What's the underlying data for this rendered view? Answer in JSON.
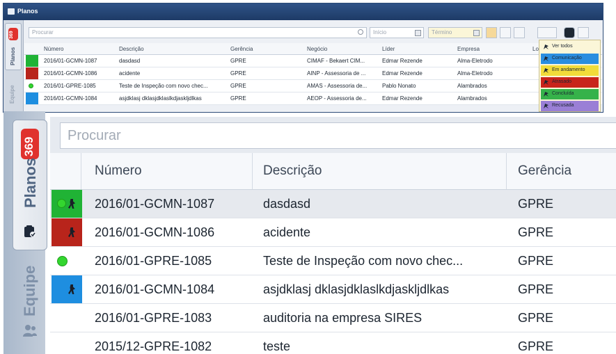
{
  "small": {
    "title": "Planos",
    "sidebar": {
      "badge": "369",
      "tab_planos": "Planos",
      "tab_equipe": "Equipe"
    },
    "search_placeholder": "Procurar",
    "date_start_placeholder": "Início",
    "date_end_placeholder": "Término",
    "columns": [
      "Número",
      "Descrição",
      "Gerência",
      "Negócio",
      "Líder",
      "Empresa",
      "Lo"
    ],
    "rows": [
      {
        "status": "green-run",
        "numero": "2016/01-GCMN-1087",
        "descricao": "dasdasd",
        "gerencia": "GPRE",
        "negocio": "CIMAF - Bekaert CIM...",
        "lider": "Edmar Rezende",
        "empresa": "Alma-Eletrodo"
      },
      {
        "status": "red",
        "numero": "2016/01-GCMN-1086",
        "descricao": "acidente",
        "gerencia": "GPRE",
        "negocio": "AINP - Assessoria de ...",
        "lider": "Edmar Rezende",
        "empresa": "Alma-Eletrodo"
      },
      {
        "status": "green-dot",
        "numero": "2016/01-GPRE-1085",
        "descricao": "Teste de Inspeção com novo chec...",
        "gerencia": "GPRE",
        "negocio": "AMAS - Assessoria de...",
        "lider": "Pablo Nonato",
        "empresa": "Alambrados"
      },
      {
        "status": "blue",
        "numero": "2016/01-GCMN-1084",
        "descricao": "asjdklasj dklasjdklaslkdjaskljdlkas",
        "gerencia": "GPRE",
        "negocio": "AEOP - Assessoria de...",
        "lider": "Edmar Rezende",
        "empresa": "Alambrados"
      }
    ],
    "filter_menu": [
      {
        "label": "Ver todos",
        "color": "#fbf6d8"
      },
      {
        "label": "Comunicação",
        "color": "#2a8ee0"
      },
      {
        "label": "Em andamento",
        "color": "#f2dc3a"
      },
      {
        "label": "Atrasado",
        "color": "#c8241b"
      },
      {
        "label": "Concluída",
        "color": "#36b24a"
      },
      {
        "label": "Recusada",
        "color": "#9a7fd6"
      }
    ]
  },
  "zoom": {
    "sidebar": {
      "badge": "369",
      "tab_planos": "Planos",
      "tab_equipe": "Equipe"
    },
    "search_placeholder": "Procurar",
    "columns": {
      "numero": "Número",
      "descricao": "Descrição",
      "gerencia": "Gerência"
    },
    "rows": [
      {
        "status": "green-run",
        "numero": "2016/01-GCMN-1087",
        "descricao": "dasdasd",
        "gerencia": "GPRE"
      },
      {
        "status": "red",
        "numero": "2016/01-GCMN-1086",
        "descricao": "acidente",
        "gerencia": "GPRE"
      },
      {
        "status": "green-dot",
        "numero": "2016/01-GPRE-1085",
        "descricao": "Teste de Inspeção com novo chec...",
        "gerencia": "GPRE"
      },
      {
        "status": "blue",
        "numero": "2016/01-GCMN-1084",
        "descricao": "asjdklasj dklasjdklaslkdjaskljdlkas",
        "gerencia": "GPRE"
      },
      {
        "status": "none",
        "numero": "2016/01-GPRE-1083",
        "descricao": "auditoria na empresa SIRES",
        "gerencia": "GPRE"
      },
      {
        "status": "none",
        "numero": "2015/12-GPRE-1082",
        "descricao": "teste",
        "gerencia": "GPRE"
      }
    ]
  },
  "status_colors": {
    "green": "#20b335",
    "red": "#b8241b",
    "blue": "#1e8ee0"
  }
}
